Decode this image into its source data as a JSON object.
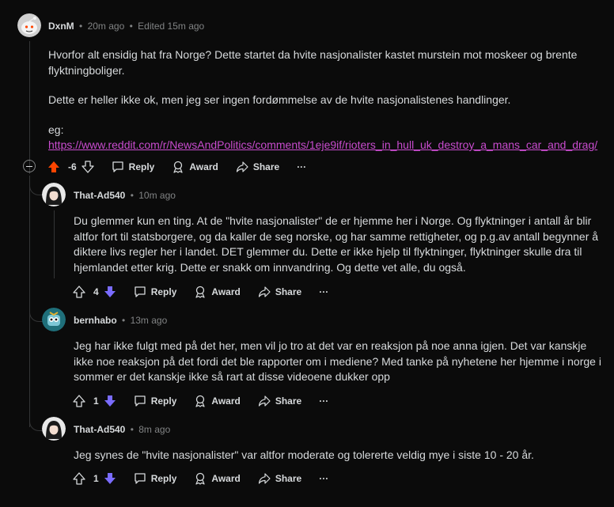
{
  "comments": [
    {
      "user": "DxnM",
      "time": "20m ago",
      "edited": "Edited 15m ago",
      "paragraphs": [
        "Hvorfor alt ensidig hat fra Norge? Dette startet da hvite nasjonalister kastet murstein mot moskeer og brente flyktningboliger.",
        "Dette er heller ikke ok, men jeg ser ingen fordømmelse av de hvite nasjonalistenes handlinger.",
        "eg:"
      ],
      "link": "https://www.reddit.com/r/NewsAndPolitics/comments/1eje9if/rioters_in_hull_uk_destroy_a_mans_car_and_drag/",
      "score": "-6",
      "vote_state": "upvoted"
    },
    {
      "user": "That-Ad540",
      "time": "10m ago",
      "paragraphs": [
        "Du glemmer kun en ting. At de \"hvite nasjonalister\" de er hjemme her i Norge. Og flyktninger i antall år blir altfor fort til statsborgere, og da kaller de seg norske, og har samme rettigheter, og p.g.av antall begynner å diktere livs regler her i landet. DET glemmer du. Dette er ikke hjelp til flyktninger, flyktninger skulle dra til hjemlandet etter krig. Dette er snakk om innvandring. Og dette vet alle, du også."
      ],
      "score": "4",
      "vote_state": "downvoted"
    },
    {
      "user": "bernhabo",
      "time": "13m ago",
      "paragraphs": [
        "Jeg har ikke fulgt med på det her, men vil jo tro at det var en reaksjon på noe anna igjen. Det var kanskje ikke noe reaksjon på det fordi det ble rapporter om i mediene? Med tanke på nyhetene her hjemme i norge i sommer er det kanskje ikke så rart at disse videoene dukker opp"
      ],
      "score": "1",
      "vote_state": "downvoted"
    },
    {
      "user": "That-Ad540",
      "time": "8m ago",
      "paragraphs": [
        "Jeg synes de \"hvite nasjonalister\" var altfor moderate og tolererte veldig mye i siste 10 - 20 år."
      ],
      "score": "1",
      "vote_state": "downvoted"
    }
  ],
  "actions": {
    "reply": "Reply",
    "award": "Award",
    "share": "Share",
    "more": "···"
  },
  "separator": "•",
  "colors": {
    "upvote": "#ff4500",
    "downvote": "#7a6cff",
    "link": "#c94ccf",
    "muted": "#818384"
  }
}
